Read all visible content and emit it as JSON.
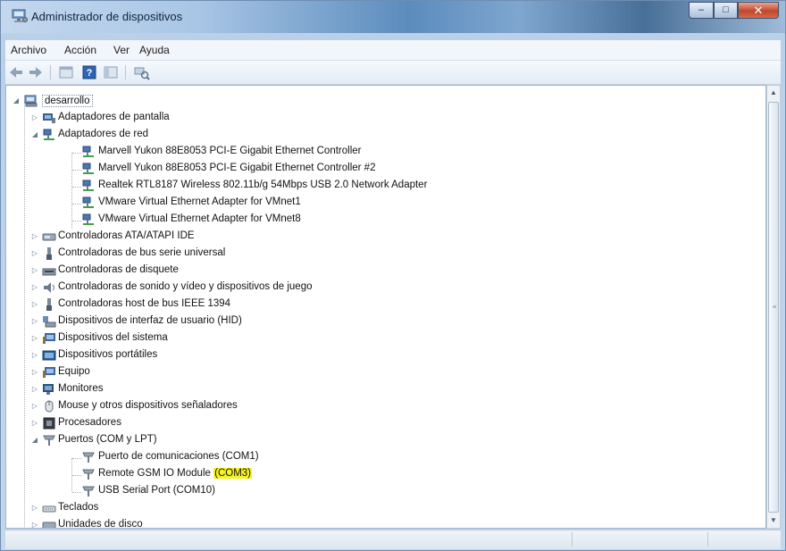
{
  "window": {
    "title": "Administrador de dispositivos",
    "controls": {
      "minimize": "–",
      "maximize": "□",
      "close": "✕"
    }
  },
  "menu": [
    "Archivo",
    "Acción",
    "Ver",
    "Ayuda"
  ],
  "toolbar": {
    "buttons": [
      "back-arrow-icon",
      "forward-arrow-icon",
      "properties-icon",
      "help-icon",
      "console-tree-icon",
      "scan-hardware-icon"
    ]
  },
  "tree": {
    "root": {
      "label": "desarrollo",
      "expanded": true
    },
    "categories": [
      {
        "label": "Adaptadores de pantalla",
        "icon": "display-adapter-icon",
        "expanded": false
      },
      {
        "label": "Adaptadores de red",
        "icon": "network-adapter-icon",
        "expanded": true,
        "children": [
          {
            "label": "Marvell Yukon 88E8053 PCI-E Gigabit Ethernet Controller",
            "icon": "network-adapter-icon"
          },
          {
            "label": "Marvell Yukon 88E8053 PCI-E Gigabit Ethernet Controller #2",
            "icon": "network-adapter-icon"
          },
          {
            "label": "Realtek RTL8187 Wireless 802.11b/g 54Mbps USB 2.0 Network Adapter",
            "icon": "network-adapter-icon"
          },
          {
            "label": "VMware Virtual Ethernet Adapter for VMnet1",
            "icon": "network-adapter-icon"
          },
          {
            "label": "VMware Virtual Ethernet Adapter for VMnet8",
            "icon": "network-adapter-icon"
          }
        ]
      },
      {
        "label": "Controladoras ATA/ATAPI IDE",
        "icon": "ide-controller-icon",
        "expanded": false
      },
      {
        "label": "Controladoras de bus serie universal",
        "icon": "usb-controller-icon",
        "expanded": false
      },
      {
        "label": "Controladoras de disquete",
        "icon": "floppy-controller-icon",
        "expanded": false
      },
      {
        "label": "Controladoras de sonido y vídeo y dispositivos de juego",
        "icon": "sound-icon",
        "expanded": false
      },
      {
        "label": "Controladoras host de bus IEEE 1394",
        "icon": "ieee1394-icon",
        "expanded": false
      },
      {
        "label": "Dispositivos de interfaz de usuario (HID)",
        "icon": "hid-icon",
        "expanded": false
      },
      {
        "label": "Dispositivos del sistema",
        "icon": "system-device-icon",
        "expanded": false
      },
      {
        "label": "Dispositivos portátiles",
        "icon": "portable-device-icon",
        "expanded": false
      },
      {
        "label": "Equipo",
        "icon": "computer-icon",
        "expanded": false
      },
      {
        "label": "Monitores",
        "icon": "monitor-icon",
        "expanded": false
      },
      {
        "label": "Mouse y otros dispositivos señaladores",
        "icon": "mouse-icon",
        "expanded": false
      },
      {
        "label": "Procesadores",
        "icon": "processor-icon",
        "expanded": false
      },
      {
        "label": "Puertos (COM y LPT)",
        "icon": "port-icon",
        "expanded": true,
        "children": [
          {
            "label": "Puerto de comunicaciones (COM1)",
            "icon": "port-icon"
          },
          {
            "label": "Remote GSM IO Module",
            "highlight": "(COM3)",
            "icon": "port-icon"
          },
          {
            "label": "USB Serial Port (COM10)",
            "icon": "port-icon"
          }
        ]
      },
      {
        "label": "Teclados",
        "icon": "keyboard-icon",
        "expanded": false
      },
      {
        "label": "Unidades de disco",
        "icon": "disk-drive-icon",
        "expanded": false
      }
    ]
  },
  "colors": {
    "highlight": "#f6f324",
    "titlebar": "#5b8cbd",
    "close": "#c2462a"
  }
}
